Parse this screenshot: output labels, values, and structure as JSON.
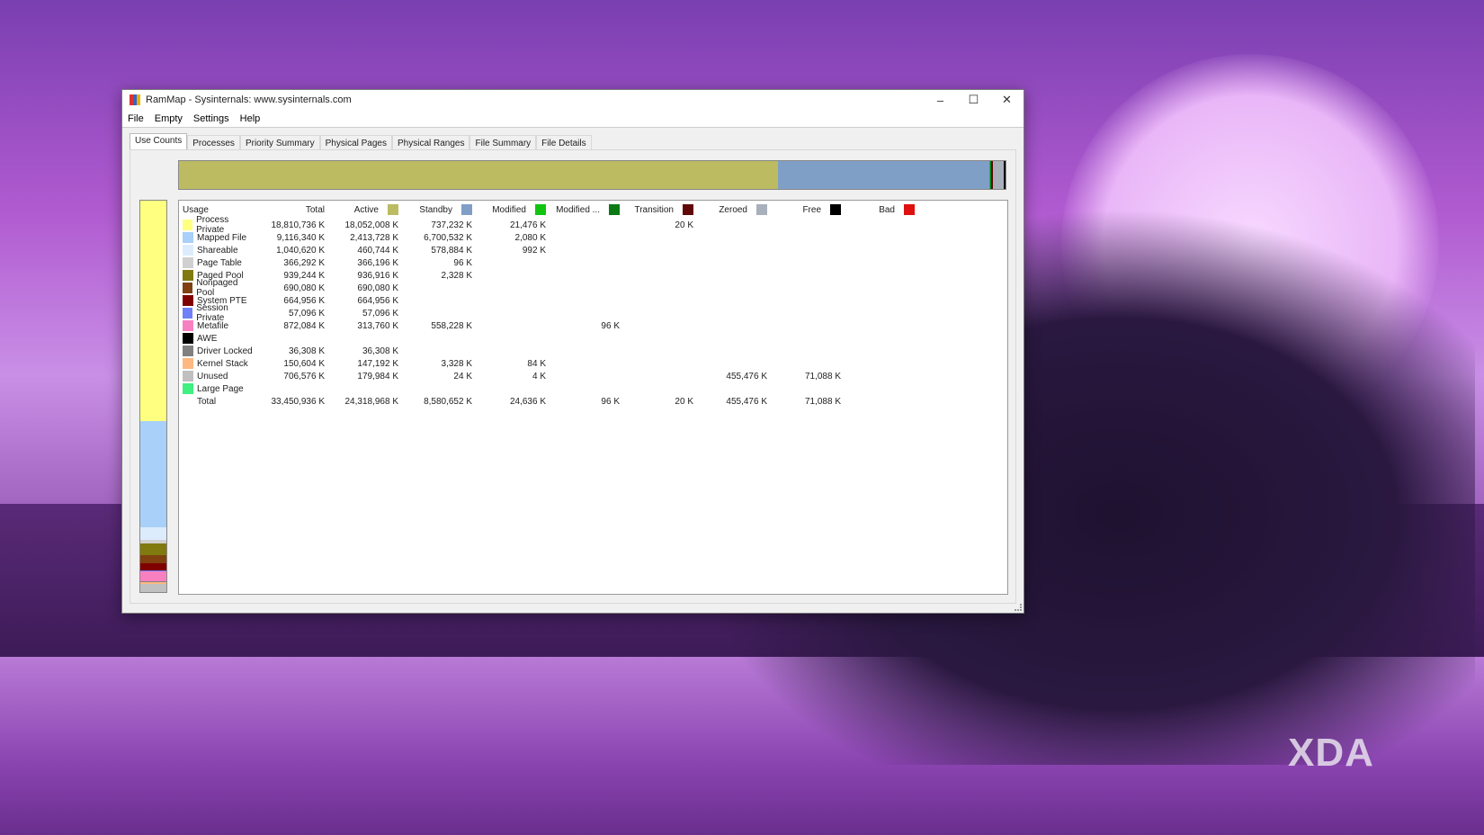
{
  "window": {
    "title": "RamMap - Sysinternals: www.sysinternals.com",
    "minimize": "–",
    "maximize": "☐",
    "close": "✕"
  },
  "menu": [
    "File",
    "Empty",
    "Settings",
    "Help"
  ],
  "tabs": [
    "Use Counts",
    "Processes",
    "Priority Summary",
    "Physical Pages",
    "Physical Ranges",
    "File Summary",
    "File Details"
  ],
  "columns": [
    {
      "label": "Usage"
    },
    {
      "label": "Total"
    },
    {
      "label": "Active",
      "color": "#bdbb62"
    },
    {
      "label": "Standby",
      "color": "#7f9fc6"
    },
    {
      "label": "Modified",
      "color": "#12c412"
    },
    {
      "label": "Modified ...",
      "color": "#0a7a14"
    },
    {
      "label": "Transition",
      "color": "#600808"
    },
    {
      "label": "Zeroed",
      "color": "#a8b0bc"
    },
    {
      "label": "Free",
      "color": "#000000"
    },
    {
      "label": "Bad",
      "color": "#e01010"
    }
  ],
  "rows": [
    {
      "name": "Process Private",
      "color": "#ffff80",
      "v": [
        "18,810,736 K",
        "18,052,008 K",
        "737,232 K",
        "21,476 K",
        "",
        "20 K",
        "",
        "",
        ""
      ]
    },
    {
      "name": "Mapped File",
      "color": "#a8d0f8",
      "v": [
        "9,116,340 K",
        "2,413,728 K",
        "6,700,532 K",
        "2,080 K",
        "",
        "",
        "",
        "",
        ""
      ]
    },
    {
      "name": "Shareable",
      "color": "#dcecfc",
      "v": [
        "1,040,620 K",
        "460,744 K",
        "578,884 K",
        "992 K",
        "",
        "",
        "",
        "",
        ""
      ]
    },
    {
      "name": "Page Table",
      "color": "#d0d0d0",
      "v": [
        "366,292 K",
        "366,196 K",
        "96 K",
        "",
        "",
        "",
        "",
        "",
        ""
      ]
    },
    {
      "name": "Paged Pool",
      "color": "#807a10",
      "v": [
        "939,244 K",
        "936,916 K",
        "2,328 K",
        "",
        "",
        "",
        "",
        "",
        ""
      ]
    },
    {
      "name": "Nonpaged Pool",
      "color": "#804010",
      "v": [
        "690,080 K",
        "690,080 K",
        "",
        "",
        "",
        "",
        "",
        "",
        ""
      ]
    },
    {
      "name": "System PTE",
      "color": "#800000",
      "v": [
        "664,956 K",
        "664,956 K",
        "",
        "",
        "",
        "",
        "",
        "",
        ""
      ]
    },
    {
      "name": "Session Private",
      "color": "#7080f8",
      "v": [
        "57,096 K",
        "57,096 K",
        "",
        "",
        "",
        "",
        "",
        "",
        ""
      ]
    },
    {
      "name": "Metafile",
      "color": "#f880c0",
      "v": [
        "872,084 K",
        "313,760 K",
        "558,228 K",
        "",
        "96 K",
        "",
        "",
        "",
        ""
      ]
    },
    {
      "name": "AWE",
      "color": "#000000",
      "v": [
        "",
        "",
        "",
        "",
        "",
        "",
        "",
        "",
        ""
      ]
    },
    {
      "name": "Driver Locked",
      "color": "#808080",
      "v": [
        "36,308 K",
        "36,308 K",
        "",
        "",
        "",
        "",
        "",
        "",
        ""
      ]
    },
    {
      "name": "Kernel Stack",
      "color": "#ffb880",
      "v": [
        "150,604 K",
        "147,192 K",
        "3,328 K",
        "84 K",
        "",
        "",
        "",
        "",
        ""
      ]
    },
    {
      "name": "Unused",
      "color": "#c0c0c0",
      "v": [
        "706,576 K",
        "179,984 K",
        "24 K",
        "4 K",
        "",
        "",
        "455,476 K",
        "71,088 K",
        ""
      ]
    },
    {
      "name": "Large Page",
      "color": "#40f080",
      "v": [
        "",
        "",
        "",
        "",
        "",
        "",
        "",
        "",
        ""
      ]
    },
    {
      "name": "Total",
      "color": "",
      "v": [
        "33,450,936 K",
        "24,318,968 K",
        "8,580,652 K",
        "24,636 K",
        "96 K",
        "20 K",
        "455,476 K",
        "71,088 K",
        ""
      ]
    }
  ],
  "totals_kb": {
    "active": 24318968,
    "standby": 8580652,
    "modified": 24636,
    "modified_nowrite": 96,
    "transition": 20,
    "zeroed": 455476,
    "free": 71088,
    "total": 33450936
  },
  "watermark": "XDA"
}
